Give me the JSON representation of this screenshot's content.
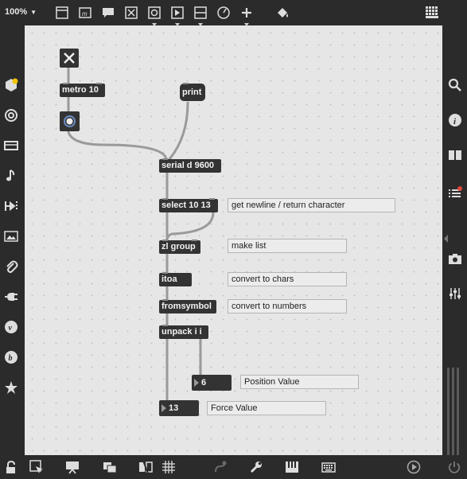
{
  "toolbar": {
    "zoom_label": "100%",
    "icons": [
      "presentation-window-icon",
      "message-icon",
      "comment-icon",
      "toggle-icon",
      "button-icon",
      "play-icon",
      "slider-icon",
      "dial-icon",
      "add-object-icon",
      "paint-bucket-icon",
      "grid-menu-icon"
    ]
  },
  "objects": {
    "metro": "metro 10",
    "print": "print",
    "serial": "serial d 9600",
    "select": "select 10 13",
    "zl_group": "zl group",
    "itoa": "itoa",
    "fromsymbol": "fromsymbol",
    "unpack": "unpack i i"
  },
  "comments": {
    "newline": "get newline / return character",
    "make_list": "make list",
    "to_chars": "convert to chars",
    "to_numbers": "convert to numbers",
    "position": "Position Value",
    "force": "Force Value"
  },
  "numbers": {
    "position_value": "6",
    "force_value": "13"
  },
  "colors": {
    "accent_badge": "#f5c400",
    "notification": "#e0463b",
    "canvas": "#e6e6e6",
    "object_bg": "#333333"
  }
}
